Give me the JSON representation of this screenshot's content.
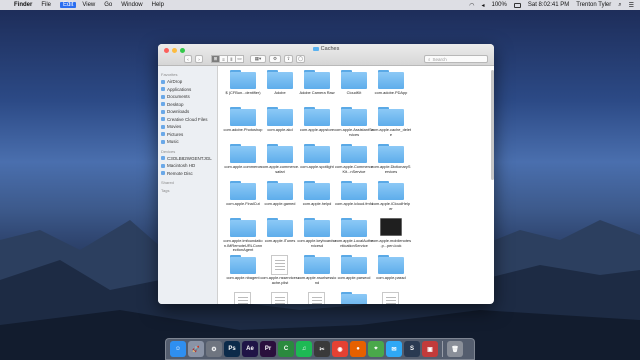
{
  "menubar": {
    "apple": "",
    "items": [
      "Finder",
      "File",
      "Edit",
      "View",
      "Go",
      "Window",
      "Help"
    ],
    "battery": "100%",
    "clock": "Sat 8:02:41 PM",
    "user": "Trenton Tyler"
  },
  "window": {
    "title": "Caches",
    "search_placeholder": "Search",
    "view_buttons": [
      "⊞",
      "≡",
      "⫴",
      "▭"
    ],
    "gear": "⚙",
    "share": "⇪",
    "tag": "◯"
  },
  "sidebar": {
    "favorites_header": "Favorites",
    "favorites": [
      {
        "label": "AirDrop",
        "icon": "airdrop-icon"
      },
      {
        "label": "Applications",
        "icon": "applications-icon"
      },
      {
        "label": "Documents",
        "icon": "documents-icon"
      },
      {
        "label": "Desktop",
        "icon": "desktop-icon"
      },
      {
        "label": "Downloads",
        "icon": "downloads-icon"
      },
      {
        "label": "Creative Cloud Files",
        "icon": "creative-cloud-icon"
      },
      {
        "label": "Movies",
        "icon": "movies-icon"
      },
      {
        "label": "Pictures",
        "icon": "pictures-icon"
      },
      {
        "label": "Music",
        "icon": "music-icon"
      }
    ],
    "devices_header": "Devices",
    "devices": [
      {
        "label": "C3OLB82WGENTJGL",
        "icon": "drive-icon"
      },
      {
        "label": "Macintosh HD",
        "icon": "hard-drive-icon"
      },
      {
        "label": "Remote Disc",
        "icon": "disc-icon"
      }
    ],
    "shared_header": "Shared",
    "tags_header": "Tags"
  },
  "files": [
    {
      "label": "$ (CFBun...dentifier)",
      "kind": "folder"
    },
    {
      "label": "Adobe",
      "kind": "folder"
    },
    {
      "label": "Adobe Camera Raw",
      "kind": "folder"
    },
    {
      "label": "CloudKit",
      "kind": "folder"
    },
    {
      "label": "com.adobe.PDApp",
      "kind": "folder"
    },
    {
      "label": "com.adobe.Photoshop",
      "kind": "folder"
    },
    {
      "label": "com.apple.akd",
      "kind": "folder"
    },
    {
      "label": "com.apple.appstore",
      "kind": "folder"
    },
    {
      "label": "com.apple.AssistantServices",
      "kind": "folder"
    },
    {
      "label": "com.apple.cache_delete",
      "kind": "folder"
    },
    {
      "label": "com.apple.commerce",
      "kind": "folder"
    },
    {
      "label": "com.apple.commerce.safari",
      "kind": "folder"
    },
    {
      "label": "com.apple.spotlight",
      "kind": "folder"
    },
    {
      "label": "com.apple.CommerceKit...nService",
      "kind": "folder"
    },
    {
      "label": "com.apple.DictionaryServices",
      "kind": "folder"
    },
    {
      "label": "com.apple.FinalCut",
      "kind": "folder"
    },
    {
      "label": "com.apple.gamed",
      "kind": "folder"
    },
    {
      "label": "com.apple.helpd",
      "kind": "folder"
    },
    {
      "label": "com.apple.icloud.fmfd",
      "kind": "folder"
    },
    {
      "label": "com.apple.iCloudHelper",
      "kind": "folder"
    },
    {
      "label": "com.apple.imfoundation.IMRemoteURLConnectionAgent",
      "kind": "folder"
    },
    {
      "label": "com.apple.iTunes",
      "kind": "folder"
    },
    {
      "label": "com.apple.keyboardservicesd",
      "kind": "folder"
    },
    {
      "label": "com.apple.LocalAuthenticationService",
      "kind": "folder"
    },
    {
      "label": "com.apple.mobilenotes.p...pen.lock",
      "kind": "terminal"
    },
    {
      "label": "com.apple.nbagent",
      "kind": "folder"
    },
    {
      "label": "com.apple.nsservicescache.plist",
      "kind": "document"
    },
    {
      "label": "com.apple.nsurlsessiond",
      "kind": "folder"
    },
    {
      "label": "com.apple.parsecd",
      "kind": "folder"
    },
    {
      "label": "com.apple.passd",
      "kind": "folder"
    },
    {
      "label": "",
      "kind": "document"
    },
    {
      "label": "",
      "kind": "document"
    },
    {
      "label": "",
      "kind": "document"
    },
    {
      "label": "",
      "kind": "folder"
    },
    {
      "label": "",
      "kind": "document"
    }
  ],
  "dock": [
    {
      "name": "finder-icon",
      "glyph": "☺",
      "color": "#2f8ff0"
    },
    {
      "name": "launchpad-icon",
      "glyph": "🚀",
      "color": "#8a93a6"
    },
    {
      "name": "system-preferences-icon",
      "glyph": "⚙",
      "color": "#6f7580"
    },
    {
      "name": "photoshop-icon",
      "glyph": "Ps",
      "color": "#0b2a4a"
    },
    {
      "name": "after-effects-icon",
      "glyph": "Ae",
      "color": "#1f1446"
    },
    {
      "name": "premiere-icon",
      "glyph": "Pr",
      "color": "#2a0f3c"
    },
    {
      "name": "camtasia-icon",
      "glyph": "C",
      "color": "#2b8a3e"
    },
    {
      "name": "spotify-icon",
      "glyph": "♫",
      "color": "#1db954"
    },
    {
      "name": "final-cut-icon",
      "glyph": "✂",
      "color": "#3a3a3a"
    },
    {
      "name": "chrome-icon",
      "glyph": "◉",
      "color": "#e34133"
    },
    {
      "name": "firefox-icon",
      "glyph": "●",
      "color": "#e66000"
    },
    {
      "name": "maps-icon",
      "glyph": "⌖",
      "color": "#4aa84a"
    },
    {
      "name": "messages-icon",
      "glyph": "✉",
      "color": "#2fa8f5"
    },
    {
      "name": "steam-icon",
      "glyph": "S",
      "color": "#2a3a52"
    },
    {
      "name": "photo-booth-icon",
      "glyph": "▣",
      "color": "#c23b3b"
    },
    {
      "name": "trash-icon",
      "glyph": "🗑",
      "color": "#8a8f99"
    }
  ]
}
